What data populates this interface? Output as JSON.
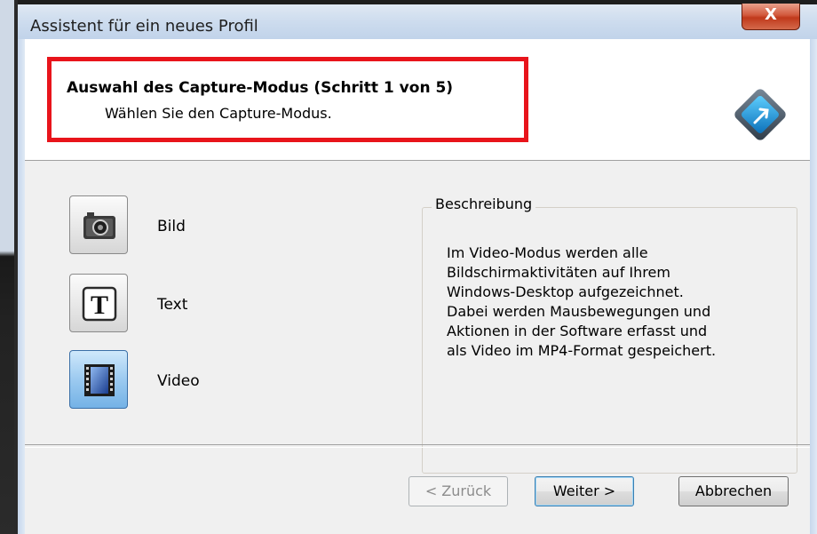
{
  "window": {
    "title": "Assistent für ein neues Profil",
    "close_label": "X"
  },
  "header": {
    "title": "Auswahl des Capture-Modus (Schritt 1 von 5)",
    "subtitle": "Wählen Sie den Capture-Modus.",
    "highlight_color": "#e8141b"
  },
  "modes": [
    {
      "label": "Bild",
      "icon": "camera-icon",
      "selected": false
    },
    {
      "label": "Text",
      "icon": "text-t-icon",
      "selected": false
    },
    {
      "label": "Video",
      "icon": "film-icon",
      "selected": true
    }
  ],
  "description": {
    "legend": "Beschreibung",
    "lines": [
      "Im Video-Modus werden alle",
      "Bildschirmaktivitäten auf Ihrem",
      "Windows-Desktop aufgezeichnet.",
      "Dabei werden Mausbewegungen und",
      "Aktionen in der Software erfasst und",
      "als Video im MP4-Format gespeichert."
    ]
  },
  "buttons": {
    "back": "< Zurück",
    "next": "Weiter >",
    "cancel": "Abbrechen"
  }
}
